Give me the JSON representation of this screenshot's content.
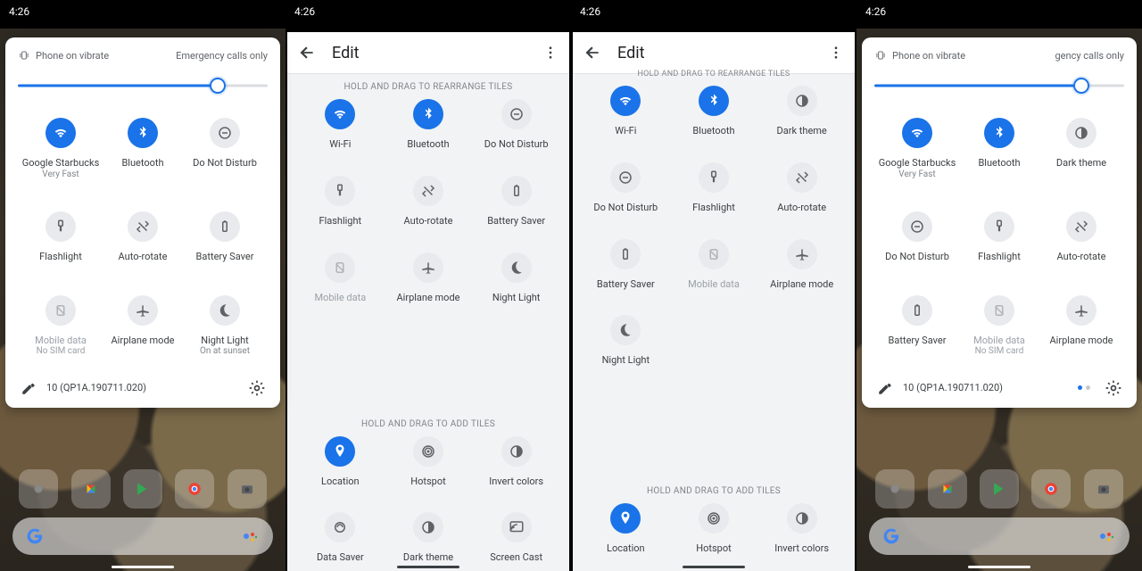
{
  "clock": "4:26",
  "qs": {
    "vibrate": "Phone on vibrate",
    "emergency1": "Emergency calls only",
    "emergency4": "gency calls only",
    "brightness_pct": 80,
    "build": "10 (QP1A.190711.020)"
  },
  "p1": {
    "t0": {
      "l": "Google Starbucks",
      "s": "Very Fast"
    },
    "t1": {
      "l": "Bluetooth"
    },
    "t2": {
      "l": "Do Not Disturb"
    },
    "t3": {
      "l": "Flashlight"
    },
    "t4": {
      "l": "Auto-rotate"
    },
    "t5": {
      "l": "Battery Saver"
    },
    "t6": {
      "l": "Mobile data",
      "s": "No SIM card"
    },
    "t7": {
      "l": "Airplane mode"
    },
    "t8": {
      "l": "Night Light",
      "s": "On at sunset"
    }
  },
  "p4": {
    "t0": {
      "l": "Google Starbucks",
      "s": "Very Fast"
    },
    "t1": {
      "l": "Bluetooth"
    },
    "t2": {
      "l": "Dark theme"
    },
    "t3": {
      "l": "Do Not Disturb"
    },
    "t4": {
      "l": "Flashlight"
    },
    "t5": {
      "l": "Auto-rotate"
    },
    "t6": {
      "l": "Battery Saver"
    },
    "t7": {
      "l": "Mobile data",
      "s": "No SIM card"
    },
    "t8": {
      "l": "Airplane mode"
    }
  },
  "edit": {
    "title": "Edit",
    "hint_rearrange": "HOLD AND DRAG TO REARRANGE TILES",
    "hint_add": "HOLD AND DRAG TO ADD TILES"
  },
  "e2": {
    "a0": {
      "l": "Wi-Fi"
    },
    "a1": {
      "l": "Bluetooth"
    },
    "a2": {
      "l": "Do Not Disturb"
    },
    "a3": {
      "l": "Flashlight"
    },
    "a4": {
      "l": "Auto-rotate"
    },
    "a5": {
      "l": "Battery Saver"
    },
    "a6": {
      "l": "Mobile data"
    },
    "a7": {
      "l": "Airplane mode"
    },
    "a8": {
      "l": "Night Light"
    },
    "b0": {
      "l": "Location"
    },
    "b1": {
      "l": "Hotspot"
    },
    "b2": {
      "l": "Invert colors"
    },
    "b3": {
      "l": "Data Saver"
    },
    "b4": {
      "l": "Dark theme"
    },
    "b5": {
      "l": "Screen Cast"
    }
  },
  "e3": {
    "a0": {
      "l": "Wi-Fi"
    },
    "a1": {
      "l": "Bluetooth"
    },
    "a2": {
      "l": "Dark theme"
    },
    "a3": {
      "l": "Do Not Disturb"
    },
    "a4": {
      "l": "Flashlight"
    },
    "a5": {
      "l": "Auto-rotate"
    },
    "a6": {
      "l": "Battery Saver"
    },
    "a7": {
      "l": "Mobile data"
    },
    "a8": {
      "l": "Airplane mode"
    },
    "a9": {
      "l": "Night Light"
    },
    "b0": {
      "l": "Location"
    },
    "b1": {
      "l": "Hotspot"
    },
    "b2": {
      "l": "Invert colors"
    }
  }
}
